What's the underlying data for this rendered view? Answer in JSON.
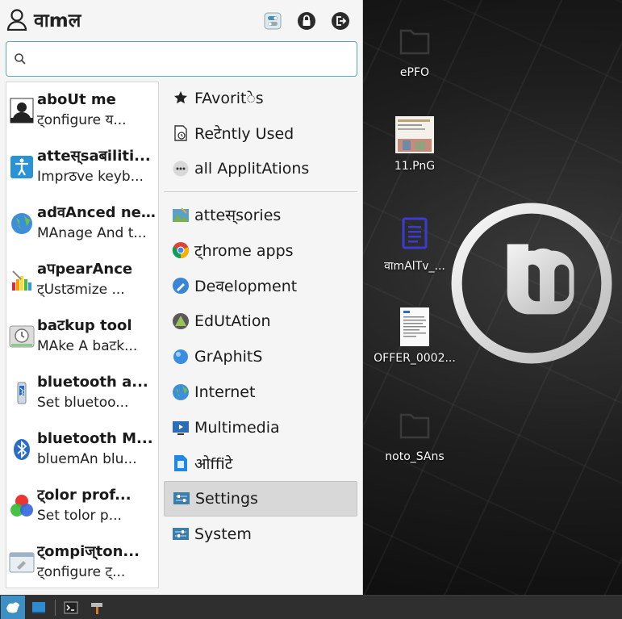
{
  "user": {
    "name": "वाmल"
  },
  "search": {
    "value": "",
    "placeholder": ""
  },
  "apps": [
    {
      "name": "aboUt me",
      "desc": "ट्onfigure य...",
      "icon": "about-me-icon"
    },
    {
      "name": "atteस्saबiliti...",
      "desc": "Imprठve keyb...",
      "icon": "accessibility-icon"
    },
    {
      "name": "adवAnced ne...",
      "desc": "MAnage And t...",
      "icon": "network-icon"
    },
    {
      "name": "aपpearAnce",
      "desc": "ट्Ustठmize ...",
      "icon": "appearance-icon"
    },
    {
      "name": "baटkup tool",
      "desc": "MAke A baटk...",
      "icon": "backup-icon"
    },
    {
      "name": "bluetooth a...",
      "desc": "Set bluetoo...",
      "icon": "bluetooth-adapter-icon"
    },
    {
      "name": "bluetooth M...",
      "desc": "bluemAn blu...",
      "icon": "bluetooth-manager-icon"
    },
    {
      "name": "ट्olor prof...",
      "desc": "Set tolor p...",
      "icon": "color-profile-icon"
    },
    {
      "name": "ट्ompiज्ton...",
      "desc": "ट्onfigure ट्...",
      "icon": "compiz-icon"
    }
  ],
  "categories": [
    {
      "label": "FAvoritेs",
      "icon": "star-icon"
    },
    {
      "label": "Reटेntly Used",
      "icon": "recent-icon"
    },
    {
      "label": "all ApplitAtions",
      "icon": "more-icon"
    },
    {
      "label": "atteस्sories",
      "icon": "accessories-icon"
    },
    {
      "label": "ट्hrome apps",
      "icon": "chrome-icon"
    },
    {
      "label": "Deवelopment",
      "icon": "development-icon"
    },
    {
      "label": "EdUtAtion",
      "icon": "education-icon"
    },
    {
      "label": "GrAphitS",
      "icon": "graphics-icon"
    },
    {
      "label": "Internet",
      "icon": "internet-icon"
    },
    {
      "label": "Multimedia",
      "icon": "multimedia-icon"
    },
    {
      "label": "ओffiटे",
      "icon": "office-icon"
    },
    {
      "label": "Settings",
      "icon": "settings-icon"
    },
    {
      "label": "System",
      "icon": "system-icon"
    }
  ],
  "desktop": [
    {
      "label": "ePFO",
      "icon": "folder-icon"
    },
    {
      "label": "11.PnG",
      "icon": "image-icon"
    },
    {
      "label": "वाmAlTv_...",
      "icon": "document-icon"
    },
    {
      "label": "OFFER_0002...",
      "icon": "pdf-icon"
    },
    {
      "label": "noto_SAns",
      "icon": "folder-icon"
    }
  ],
  "colors": {
    "accent": "#5aa7b8",
    "selected": "#d8d8d8"
  }
}
